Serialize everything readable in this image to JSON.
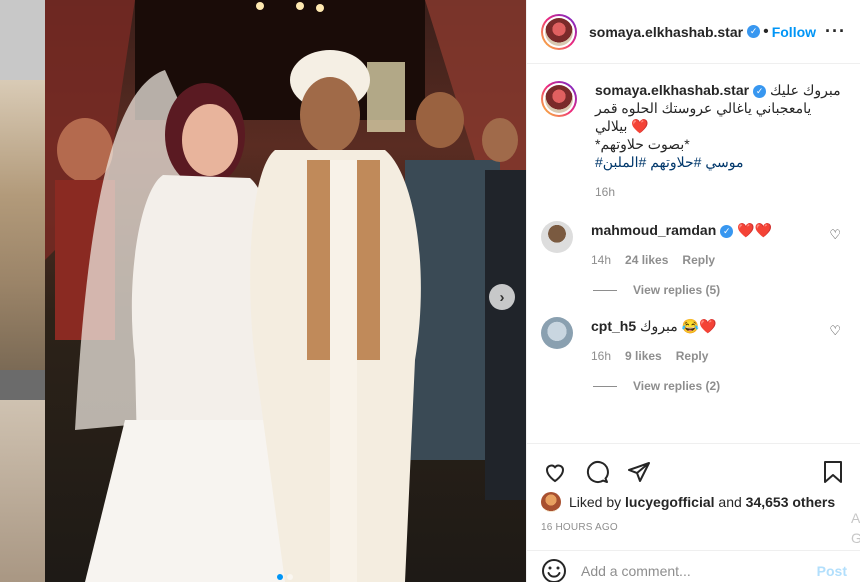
{
  "post": {
    "username": "somaya.elkhashab.star",
    "follow_label": "Follow",
    "more_icon": "more-icon",
    "caption_line1": "مبروك عليك",
    "caption_line2": "يامعجباني ياغالي عروستك الحلوه قمر",
    "caption_line3": "بيلالي",
    "caption_line4": "*بصوت حلاوتهم*",
    "caption_hashtags": "موسي #حلاوتهم #الملبن#",
    "caption_time": "16h"
  },
  "comments": [
    {
      "username": "mahmoud_ramdan",
      "text": "",
      "hearts": "❤️❤️",
      "time": "14h",
      "likes": "24 likes",
      "reply": "Reply",
      "view_replies": "View replies (5)"
    },
    {
      "username": "cpt_h5",
      "text": "مبروك",
      "hearts": "❤️",
      "time": "16h",
      "likes": "9 likes",
      "reply": "Reply",
      "view_replies": "View replies (2)"
    }
  ],
  "likes": {
    "prefix": "Liked by ",
    "user": "lucyegofficial",
    "middle": " and ",
    "count": "34,653 others"
  },
  "timestamp": "16 HOURS AGO",
  "add_comment": {
    "placeholder": "Add a comment...",
    "post_label": "Post"
  },
  "edge_text": "A G",
  "colors": {
    "accent": "#0095f6",
    "verified": "#3897f0",
    "heart": "#ed1c24",
    "muted": "#8e8e8e"
  },
  "carousel": {
    "slides": 2,
    "active": 1
  }
}
